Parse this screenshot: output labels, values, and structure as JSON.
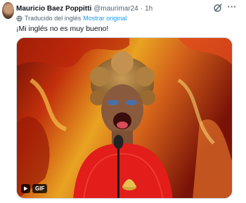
{
  "tweet": {
    "author_name": "Mauricio Baez Poppitti",
    "author_handle": "@maurimar24",
    "separator": "·",
    "time_ago": "1h",
    "translated_label": "Traducido del inglés",
    "show_original_label": "Mostrar original",
    "text": "¡Mi inglés no es muy bueno!",
    "media": {
      "type": "gif",
      "badge_label": "GIF"
    }
  },
  "icons": {
    "grok": "grok-icon",
    "more": "more-icon",
    "translate": "translate-icon",
    "play": "play-icon"
  },
  "colors": {
    "link": "#1d9bf0",
    "secondary_text": "#536471",
    "primary_text": "#0f1419"
  }
}
